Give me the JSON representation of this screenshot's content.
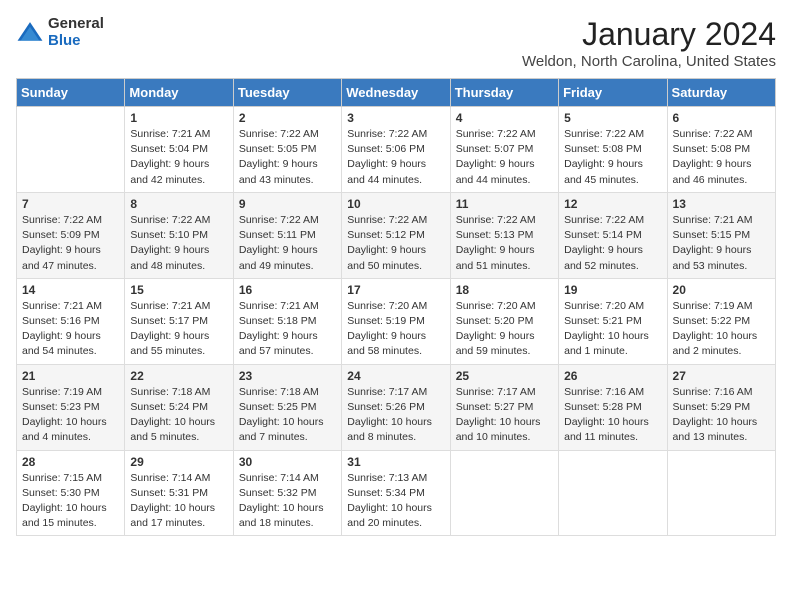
{
  "logo": {
    "general": "General",
    "blue": "Blue"
  },
  "title": "January 2024",
  "location": "Weldon, North Carolina, United States",
  "days_of_week": [
    "Sunday",
    "Monday",
    "Tuesday",
    "Wednesday",
    "Thursday",
    "Friday",
    "Saturday"
  ],
  "weeks": [
    [
      {
        "day": null,
        "info": null
      },
      {
        "day": "1",
        "sunrise": "7:21 AM",
        "sunset": "5:04 PM",
        "daylight": "9 hours and 42 minutes."
      },
      {
        "day": "2",
        "sunrise": "7:22 AM",
        "sunset": "5:05 PM",
        "daylight": "9 hours and 43 minutes."
      },
      {
        "day": "3",
        "sunrise": "7:22 AM",
        "sunset": "5:06 PM",
        "daylight": "9 hours and 44 minutes."
      },
      {
        "day": "4",
        "sunrise": "7:22 AM",
        "sunset": "5:07 PM",
        "daylight": "9 hours and 44 minutes."
      },
      {
        "day": "5",
        "sunrise": "7:22 AM",
        "sunset": "5:08 PM",
        "daylight": "9 hours and 45 minutes."
      },
      {
        "day": "6",
        "sunrise": "7:22 AM",
        "sunset": "5:08 PM",
        "daylight": "9 hours and 46 minutes."
      }
    ],
    [
      {
        "day": "7",
        "sunrise": "7:22 AM",
        "sunset": "5:09 PM",
        "daylight": "9 hours and 47 minutes."
      },
      {
        "day": "8",
        "sunrise": "7:22 AM",
        "sunset": "5:10 PM",
        "daylight": "9 hours and 48 minutes."
      },
      {
        "day": "9",
        "sunrise": "7:22 AM",
        "sunset": "5:11 PM",
        "daylight": "9 hours and 49 minutes."
      },
      {
        "day": "10",
        "sunrise": "7:22 AM",
        "sunset": "5:12 PM",
        "daylight": "9 hours and 50 minutes."
      },
      {
        "day": "11",
        "sunrise": "7:22 AM",
        "sunset": "5:13 PM",
        "daylight": "9 hours and 51 minutes."
      },
      {
        "day": "12",
        "sunrise": "7:22 AM",
        "sunset": "5:14 PM",
        "daylight": "9 hours and 52 minutes."
      },
      {
        "day": "13",
        "sunrise": "7:21 AM",
        "sunset": "5:15 PM",
        "daylight": "9 hours and 53 minutes."
      }
    ],
    [
      {
        "day": "14",
        "sunrise": "7:21 AM",
        "sunset": "5:16 PM",
        "daylight": "9 hours and 54 minutes."
      },
      {
        "day": "15",
        "sunrise": "7:21 AM",
        "sunset": "5:17 PM",
        "daylight": "9 hours and 55 minutes."
      },
      {
        "day": "16",
        "sunrise": "7:21 AM",
        "sunset": "5:18 PM",
        "daylight": "9 hours and 57 minutes."
      },
      {
        "day": "17",
        "sunrise": "7:20 AM",
        "sunset": "5:19 PM",
        "daylight": "9 hours and 58 minutes."
      },
      {
        "day": "18",
        "sunrise": "7:20 AM",
        "sunset": "5:20 PM",
        "daylight": "9 hours and 59 minutes."
      },
      {
        "day": "19",
        "sunrise": "7:20 AM",
        "sunset": "5:21 PM",
        "daylight": "10 hours and 1 minute."
      },
      {
        "day": "20",
        "sunrise": "7:19 AM",
        "sunset": "5:22 PM",
        "daylight": "10 hours and 2 minutes."
      }
    ],
    [
      {
        "day": "21",
        "sunrise": "7:19 AM",
        "sunset": "5:23 PM",
        "daylight": "10 hours and 4 minutes."
      },
      {
        "day": "22",
        "sunrise": "7:18 AM",
        "sunset": "5:24 PM",
        "daylight": "10 hours and 5 minutes."
      },
      {
        "day": "23",
        "sunrise": "7:18 AM",
        "sunset": "5:25 PM",
        "daylight": "10 hours and 7 minutes."
      },
      {
        "day": "24",
        "sunrise": "7:17 AM",
        "sunset": "5:26 PM",
        "daylight": "10 hours and 8 minutes."
      },
      {
        "day": "25",
        "sunrise": "7:17 AM",
        "sunset": "5:27 PM",
        "daylight": "10 hours and 10 minutes."
      },
      {
        "day": "26",
        "sunrise": "7:16 AM",
        "sunset": "5:28 PM",
        "daylight": "10 hours and 11 minutes."
      },
      {
        "day": "27",
        "sunrise": "7:16 AM",
        "sunset": "5:29 PM",
        "daylight": "10 hours and 13 minutes."
      }
    ],
    [
      {
        "day": "28",
        "sunrise": "7:15 AM",
        "sunset": "5:30 PM",
        "daylight": "10 hours and 15 minutes."
      },
      {
        "day": "29",
        "sunrise": "7:14 AM",
        "sunset": "5:31 PM",
        "daylight": "10 hours and 17 minutes."
      },
      {
        "day": "30",
        "sunrise": "7:14 AM",
        "sunset": "5:32 PM",
        "daylight": "10 hours and 18 minutes."
      },
      {
        "day": "31",
        "sunrise": "7:13 AM",
        "sunset": "5:34 PM",
        "daylight": "10 hours and 20 minutes."
      },
      {
        "day": null,
        "info": null
      },
      {
        "day": null,
        "info": null
      },
      {
        "day": null,
        "info": null
      }
    ]
  ],
  "labels": {
    "sunrise": "Sunrise:",
    "sunset": "Sunset:",
    "daylight": "Daylight:"
  }
}
